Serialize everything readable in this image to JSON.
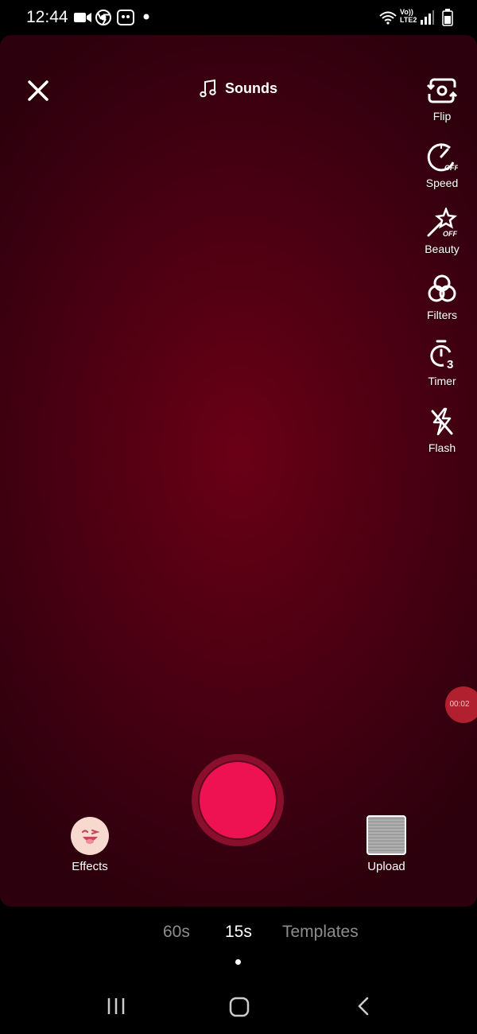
{
  "status_bar": {
    "time": "12:44",
    "network_label_top": "Vo))",
    "network_label_bottom": "LTE2"
  },
  "camera": {
    "sounds_label": "Sounds",
    "side_tools": [
      {
        "label": "Flip",
        "icon": "flip-camera-icon"
      },
      {
        "label": "Speed",
        "icon": "speed-icon",
        "badge": "OFF"
      },
      {
        "label": "Beauty",
        "icon": "beauty-wand-icon",
        "badge": "OFF"
      },
      {
        "label": "Filters",
        "icon": "filters-icon"
      },
      {
        "label": "Timer",
        "icon": "timer-icon",
        "badge": "3"
      },
      {
        "label": "Flash",
        "icon": "flash-off-icon"
      }
    ],
    "recording_timer": "00:02",
    "effects_label": "Effects",
    "upload_label": "Upload"
  },
  "modes": {
    "items": [
      "60s",
      "15s",
      "Templates"
    ],
    "active": "15s"
  },
  "colors": {
    "record_button": "#ee1252",
    "record_ring": "#8a0f2c",
    "camera_background": "#4e0012"
  }
}
